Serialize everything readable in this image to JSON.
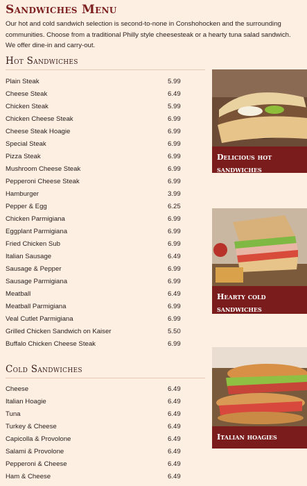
{
  "page": {
    "title": "Sandwiches Menu",
    "intro": "Our hot and cold sandwich selection is second-to-none in Conshohocken and the surrounding communities. Choose from a traditional Philly style cheesesteak or a hearty tuna salad sandwich. We offer dine-in and carry-out."
  },
  "hot": {
    "title": "Hot Sandwiches",
    "items": [
      {
        "name": "Plain Steak",
        "price": "5.99"
      },
      {
        "name": "Cheese Steak",
        "price": "6.49"
      },
      {
        "name": "Chicken Steak",
        "price": "5.99"
      },
      {
        "name": "Chicken Cheese Steak",
        "price": "6.99"
      },
      {
        "name": "Cheese Steak Hoagie",
        "price": "6.99"
      },
      {
        "name": "Special Steak",
        "price": "6.99"
      },
      {
        "name": "Pizza Steak",
        "price": "6.99"
      },
      {
        "name": "Mushroom Cheese Steak",
        "price": "6.99"
      },
      {
        "name": "Pepperoni Cheese Steak",
        "price": "6.99"
      },
      {
        "name": "Hamburger",
        "price": "3.99"
      },
      {
        "name": "Pepper & Egg",
        "price": "6.25"
      },
      {
        "name": "Chicken Parmigiana",
        "price": "6.99"
      },
      {
        "name": "Eggplant Parmigiana",
        "price": "6.99"
      },
      {
        "name": "Fried Chicken Sub",
        "price": "6.99"
      },
      {
        "name": "Italian Sausage",
        "price": "6.49"
      },
      {
        "name": "Sausage & Pepper",
        "price": "6.99"
      },
      {
        "name": "Sausage Parmigiana",
        "price": "6.99"
      },
      {
        "name": "Meatball",
        "price": "6.49"
      },
      {
        "name": "Meatball Parmigiana",
        "price": "6.99"
      },
      {
        "name": "Veal Cutlet Parmigiana",
        "price": "6.99"
      },
      {
        "name": "Grilled Chicken Sandwich on Kaiser",
        "price": "5.50"
      },
      {
        "name": "Buffalo Chicken Cheese Steak",
        "price": "6.99"
      }
    ]
  },
  "cold": {
    "title": "Cold Sandwiches",
    "items": [
      {
        "name": "Cheese",
        "price": "6.49"
      },
      {
        "name": "Italian Hoagie",
        "price": "6.49"
      },
      {
        "name": "Tuna",
        "price": "6.49"
      },
      {
        "name": "Turkey & Cheese",
        "price": "6.49"
      },
      {
        "name": "Capicolla & Provolone",
        "price": "6.49"
      },
      {
        "name": "Salami & Provolone",
        "price": "6.49"
      },
      {
        "name": "Pepperoni & Cheese",
        "price": "6.49"
      },
      {
        "name": "Ham & Cheese",
        "price": "6.49"
      }
    ]
  },
  "promos": [
    {
      "label_1": "Delicious hot",
      "label_2": "sandwiches"
    },
    {
      "label_1": "Hearty cold",
      "label_2": "sandwiches"
    },
    {
      "label_1": "Italian hoagies",
      "label_2": ""
    }
  ],
  "colors": {
    "accent": "#7a1c1c",
    "background": "#fdf0e2"
  }
}
